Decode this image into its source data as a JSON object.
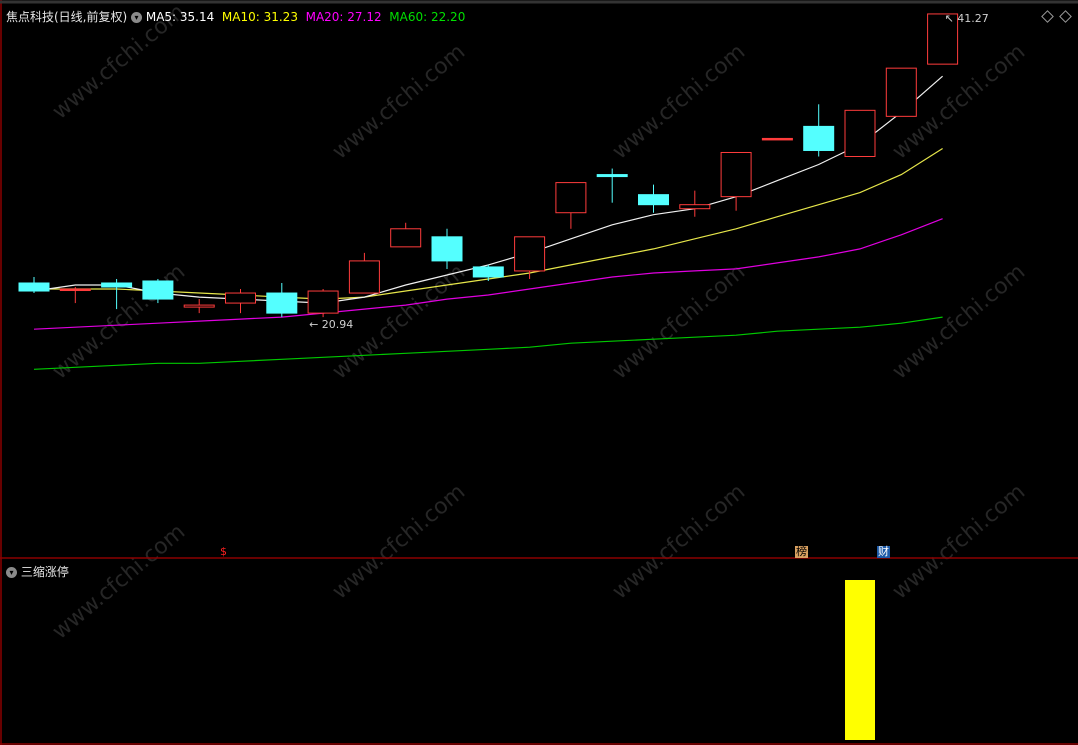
{
  "header": {
    "title": "焦点科技(日线,前复权)",
    "ma": [
      {
        "label": "MA5: 35.14",
        "color": "#ffffff"
      },
      {
        "label": "MA10: 31.23",
        "color": "#ffff00"
      },
      {
        "label": "MA20: 27.12",
        "color": "#ff00ff"
      },
      {
        "label": "MA60: 22.20",
        "color": "#00e000"
      }
    ]
  },
  "indicator": {
    "title": "三缩涨停"
  },
  "markers": {
    "dividend": "$",
    "rank": "榜",
    "finance": "财"
  },
  "watermark": "www.cfchi.com",
  "colors": {
    "up": "#ff3c3c",
    "down": "#54ffff",
    "indicator_bar": "#ffff00",
    "separator": "#8b0000"
  },
  "chart_data": {
    "type": "candlestick",
    "ylim": [
      17.5,
      43
    ],
    "candles": [
      {
        "o": 30.3,
        "h": 30.6,
        "l": 29.8,
        "c": 29.9
      },
      {
        "o": 30.0,
        "h": 30.1,
        "l": 29.3,
        "c": 30.0
      },
      {
        "o": 30.3,
        "h": 30.5,
        "l": 29.0,
        "c": 30.1
      },
      {
        "o": 30.4,
        "h": 30.5,
        "l": 29.3,
        "c": 29.5
      },
      {
        "o": 29.1,
        "h": 29.5,
        "l": 28.8,
        "c": 29.2
      },
      {
        "o": 29.3,
        "h": 30.0,
        "l": 28.8,
        "c": 29.8
      },
      {
        "o": 29.8,
        "h": 30.3,
        "l": 28.6,
        "c": 28.8
      },
      {
        "o": 28.8,
        "h": 30.0,
        "l": 28.6,
        "c": 29.9
      },
      {
        "o": 29.8,
        "h": 31.8,
        "l": 29.8,
        "c": 31.4
      },
      {
        "o": 32.1,
        "h": 33.3,
        "l": 32.1,
        "c": 33.0
      },
      {
        "o": 32.6,
        "h": 33.0,
        "l": 31.0,
        "c": 31.4
      },
      {
        "o": 31.1,
        "h": 31.2,
        "l": 30.4,
        "c": 30.6
      },
      {
        "o": 30.9,
        "h": 32.6,
        "l": 30.5,
        "c": 32.6
      },
      {
        "o": 33.8,
        "h": 34.4,
        "l": 33.0,
        "c": 35.3
      },
      {
        "o": 35.7,
        "h": 36.0,
        "l": 34.3,
        "c": 35.6
      },
      {
        "o": 34.7,
        "h": 35.2,
        "l": 33.8,
        "c": 34.2
      },
      {
        "o": 34.0,
        "h": 34.9,
        "l": 33.6,
        "c": 34.2
      },
      {
        "o": 34.6,
        "h": 36.8,
        "l": 33.9,
        "c": 36.8
      },
      {
        "o": 37.5,
        "h": 37.5,
        "l": 37.5,
        "c": 37.5
      },
      {
        "o": 38.1,
        "h": 39.2,
        "l": 36.6,
        "c": 36.9
      },
      {
        "o": 36.6,
        "h": 38.9,
        "l": 36.6,
        "c": 38.9
      },
      {
        "o": 38.6,
        "h": 38.6,
        "l": 38.6,
        "c": 41.0
      },
      {
        "o": 41.2,
        "h": 41.3,
        "l": 41.2,
        "c": 43.7
      }
    ],
    "ma5": [
      29.9,
      30.2,
      30.2,
      29.8,
      29.6,
      29.5,
      29.4,
      29.3,
      29.6,
      30.2,
      30.7,
      31.2,
      31.8,
      32.5,
      33.2,
      33.7,
      34.0,
      34.6,
      35.4,
      36.2,
      37.2,
      38.8,
      40.6
    ],
    "ma10": [
      30.0,
      30.0,
      30.0,
      29.9,
      29.8,
      29.7,
      29.6,
      29.5,
      29.6,
      29.9,
      30.2,
      30.5,
      30.8,
      31.2,
      31.6,
      32.0,
      32.5,
      33.0,
      33.6,
      34.2,
      34.8,
      35.7,
      37.0
    ],
    "ma20": [
      28.0,
      28.1,
      28.2,
      28.3,
      28.4,
      28.5,
      28.6,
      28.8,
      29.0,
      29.2,
      29.5,
      29.7,
      30.0,
      30.3,
      30.6,
      30.8,
      30.9,
      31.0,
      31.3,
      31.6,
      32.0,
      32.7,
      33.5
    ],
    "ma60": [
      26.0,
      26.1,
      26.2,
      26.3,
      26.3,
      26.4,
      26.5,
      26.6,
      26.7,
      26.8,
      26.9,
      27.0,
      27.1,
      27.3,
      27.4,
      27.5,
      27.6,
      27.7,
      27.9,
      28.0,
      28.1,
      28.3,
      28.6
    ],
    "annotations": {
      "low_label": "20.94",
      "high_label": "41.27"
    },
    "indicator_bars": [
      0,
      0,
      0,
      0,
      0,
      0,
      0,
      0,
      0,
      0,
      0,
      0,
      0,
      0,
      0,
      0,
      0,
      0,
      0,
      0,
      1,
      0,
      0
    ]
  }
}
